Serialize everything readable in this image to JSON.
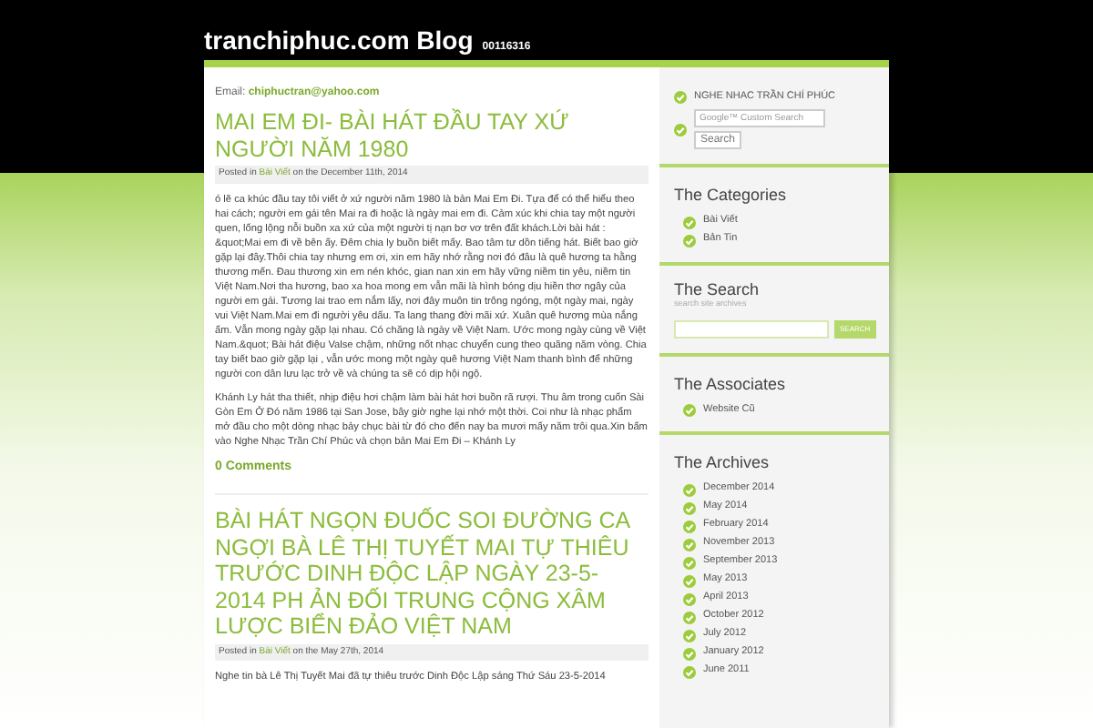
{
  "header": {
    "title": "tranchiphuc.com Blog",
    "counter": "00116316"
  },
  "email": {
    "label": "Email:",
    "address": "chiphuctran@yahoo.com"
  },
  "posts": [
    {
      "title": "MAI EM ĐI- BÀI HÁT ĐẦU TAY XỨ NGƯỜI NĂM 1980",
      "posted_in": "Posted in",
      "category": "Bài Viết",
      "date": "on the December 11th, 2014",
      "paragraphs": [
        "ó lẽ ca khúc đầu tay tôi viết ở xứ người năm 1980 là bản Mai Em Đi. Tựa để có thể hiểu theo hai cách; người em gái tên Mai ra đi hoặc là ngày mai em đi. Cảm xúc khi chia tay một người quen, lống lộng nỗi buồn xa xứ của một người tị nạn bơ vơ trên đất khách.Lời bài hát : &quot;Mai em đi về bên ấy. Đêm chia ly buồn biết mấy. Bao tâm tư dồn tiếng hát. Biết bao giờ gặp lại đây.Thôi chia tay nhưng em ơi, xin em hãy nhớ rằng nơi đó đâu là quê hương ta hằng thương mến. Đau thương xin em nén khóc, gian nan xin em hãy vững niềm tin yêu, niềm tin Việt Nam.Nơi tha hương, bao xa hoa mong em vẫn mãi là hình bóng dịu hiền thơ ngây của người em gái. Tương lai trao em nắm lấy, nơi đây muôn tin trông ngóng, một ngày mai, ngày vui Việt Nam.Mai em đi người yêu dấu. Ta lang thang đời mãi xứ. Xuân quê hương mùa nắng ấm. Vẫn mong ngày gặp lại nhau. Có chăng là ngày về Việt Nam. Ước mong ngày cùng về Việt Nam.&quot; Bài hát điệu Valse chậm, những nốt nhạc chuyển cung theo quãng năm vòng. Chia tay biết bao giờ gặp lại , vẫn ước mong một ngày quê hương Việt Nam thanh bình để những người con dân lưu lạc trở về và chúng ta sẽ có dịp hội ngộ.",
        "Khánh Ly hát tha thiết, nhịp điệu hơi chậm làm bài hát hơi buồn rã rượi. Thu âm trong cuốn Sài Gòn Em Ở Đó năm 1986 tại San Jose, bây giờ nghe lại nhớ một thời. Coi như là nhạc phẩm mở đầu cho một dòng nhạc bảy chục bài từ đó cho đến nay ba mươi mấy năm trôi qua.Xin bấm vào Nghe Nhạc Trần Chí Phúc và chọn bản Mai Em Đi – Khánh Ly"
      ],
      "comments": "0 Comments"
    },
    {
      "title": "BÀI HÁT NGỌN ĐUỐC SOI ĐƯỜNG CA NGỢI BÀ LÊ THỊ TUYẾT MAI TỰ THIÊU TRƯỚC DINH ĐỘC LẬP NGÀY 23-5-2014 PH ẢN ĐỐI TRUNG CỘNG XÂM LƯỢC BIỂN ĐẢO VIỆT NAM",
      "posted_in": "Posted in",
      "category": "Bài Viết",
      "date": "on the May 27th, 2014",
      "paragraphs": [
        "Nghe tin bà Lê Thị Tuyết Mai đã tự thiêu trước Dinh Độc Lập sáng Thứ Sáu 23-5-2014"
      ]
    }
  ],
  "sidebar": [
    {
      "kind": "google",
      "label": "NGHE NHAC TRẦN CHÍ PHÚC",
      "placeholder": "Google™ Custom Search",
      "button": "Search"
    },
    {
      "kind": "links",
      "heading": "The Categories",
      "items": [
        "Bài Viết",
        "Bản Tin"
      ]
    },
    {
      "kind": "search",
      "heading": "The Search",
      "subtitle": "search site archives",
      "button": "SEARCH"
    },
    {
      "kind": "links",
      "heading": "The Associates",
      "items": [
        "Website Cũ"
      ]
    },
    {
      "kind": "links",
      "heading": "The Archives",
      "items": [
        "December 2014",
        "May 2014",
        "February 2014",
        "November 2013",
        "September 2013",
        "May 2013",
        "April 2013",
        "October 2012",
        "July 2012",
        "January 2012",
        "June 2011"
      ]
    }
  ]
}
